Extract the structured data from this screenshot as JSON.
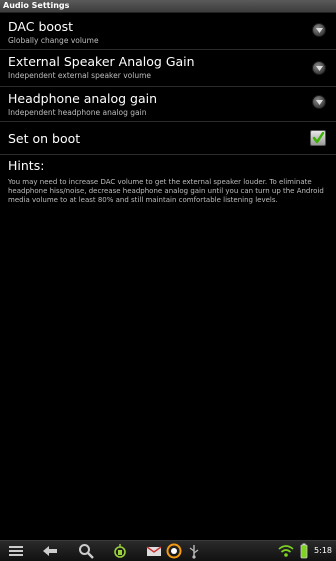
{
  "window": {
    "title": "Audio Settings"
  },
  "prefs": [
    {
      "title": "DAC boost",
      "summary": "Globally change volume"
    },
    {
      "title": "External Speaker Analog Gain",
      "summary": "Independent external speaker volume"
    },
    {
      "title": "Headphone analog gain",
      "summary": "Independent headphone analog gain"
    }
  ],
  "set_on_boot": {
    "label": "Set on boot",
    "checked": true
  },
  "hints": {
    "title": "Hints:",
    "text": "You may need to increase DAC volume to get the external speaker louder. To eliminate headphone hiss/noise, decrease headphone analog gain until you can turn up the Android media volume to at least 80% and still maintain comfortable listening levels."
  },
  "statusbar": {
    "time": "5:18",
    "icons": [
      "menu-icon",
      "back-icon",
      "search-icon",
      "android-icon",
      "gmail-icon",
      "music-icon",
      "usb-icon",
      "wifi-icon",
      "battery-icon"
    ]
  },
  "colors": {
    "background": "#000000",
    "summary_text": "#bdbdbd",
    "checkmark": "#3ab300",
    "wifi": "#7ed321"
  }
}
